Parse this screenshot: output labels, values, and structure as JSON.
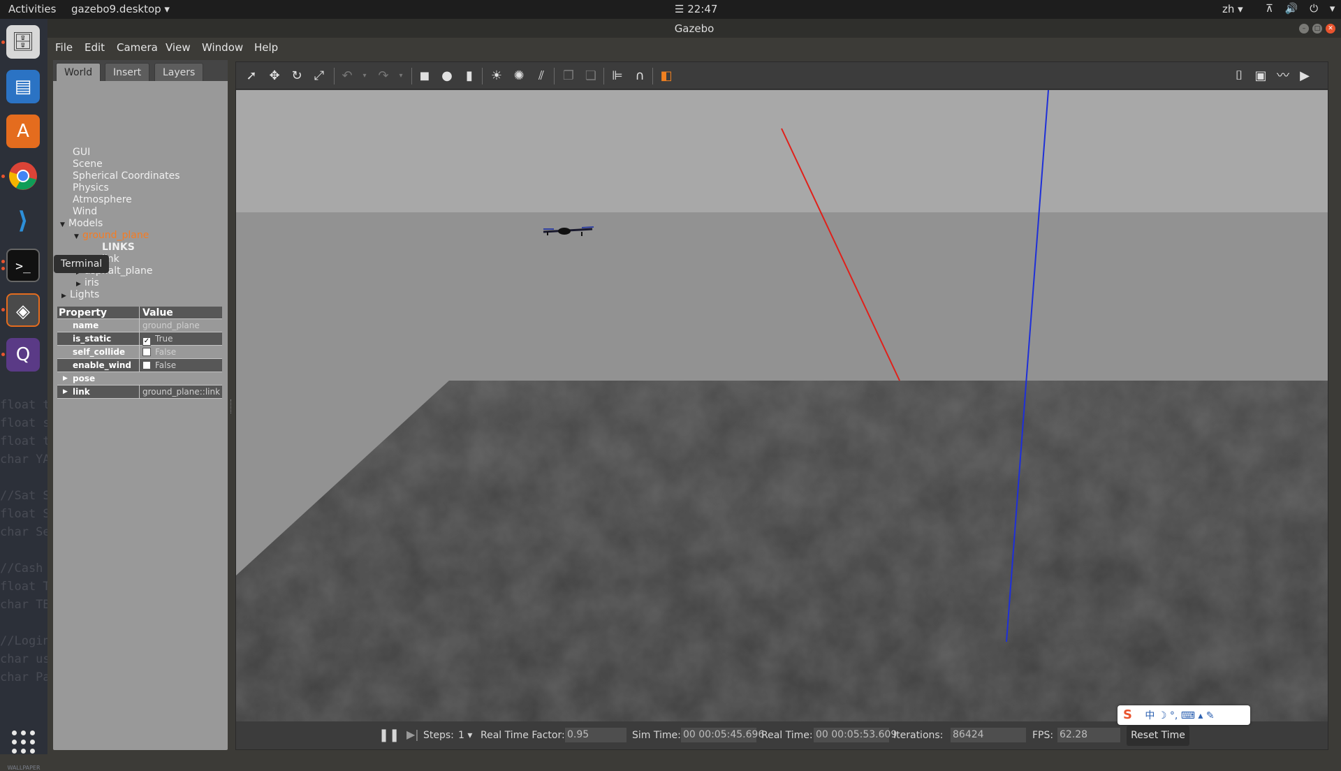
{
  "top_panel": {
    "activities": "Activities",
    "app_menu": "gazebo9.desktop ▾",
    "clock": "☰ 22:47",
    "language": "zh ▾",
    "tray": "⊼ 🔊 ⏻ ▾"
  },
  "window": {
    "title": "Gazebo",
    "minimize": "–",
    "maximize": "□",
    "close": "✕"
  },
  "menubar": {
    "file": "File",
    "edit": "Edit",
    "camera": "Camera",
    "view": "View",
    "window": "Window",
    "help": "Help"
  },
  "launcher": {
    "items": [
      "file-manager-icon",
      "writer-icon",
      "software-center-icon",
      "chrome-icon",
      "vscode-icon",
      "terminal-icon",
      "gazebo-icon",
      "qgroundcontrol-icon"
    ],
    "wallpaper_label": "WALLPAPER"
  },
  "side_panel": {
    "tabs": [
      "World",
      "Insert",
      "Layers"
    ],
    "active_tab": "World",
    "tree": {
      "gui": "GUI",
      "scene": "Scene",
      "spherical": "Spherical Coordinates",
      "physics": "Physics",
      "atmosphere": "Atmosphere",
      "wind": "Wind",
      "models": "Models",
      "ground_plane": "ground_plane",
      "links": "LINKS",
      "link": "link",
      "asphalt_plane": "asphalt_plane",
      "iris": "iris",
      "lights": "Lights"
    },
    "tooltip": "Terminal",
    "properties": {
      "header_property": "Property",
      "header_value": "Value",
      "name_key": "name",
      "name_val": "ground_plane",
      "is_static_key": "is_static",
      "is_static_val": "True",
      "self_collide_key": "self_collide",
      "self_collide_val": "False",
      "enable_wind_key": "enable_wind",
      "enable_wind_val": "False",
      "pose_key": "pose",
      "link_key": "link",
      "link_val": "ground_plane::link"
    }
  },
  "toolbar": {
    "icons": [
      "select-icon",
      "translate-icon",
      "rotate-icon",
      "scale-icon",
      "undo-icon",
      "redo-icon",
      "box-icon",
      "sphere-icon",
      "cylinder-icon",
      "point-light-icon",
      "spot-light-icon",
      "directional-light-icon",
      "copy-icon",
      "paste-icon",
      "align-icon",
      "snap-icon",
      "view-angle-icon",
      "screenshot-icon",
      "log-icon",
      "plot-icon",
      "record-icon"
    ]
  },
  "statusbar": {
    "steps_label": "Steps:",
    "steps_value": "1 ▾",
    "rtf_label": "Real Time Factor:",
    "rtf_value": "0.95",
    "sim_time_label": "Sim Time:",
    "sim_time_value": "00 00:05:45.696",
    "real_time_label": "Real Time:",
    "real_time_value": "00 00:05:53.609",
    "iterations_label": "Iterations:",
    "iterations_value": "86424",
    "fps_label": "FPS:",
    "fps_value": "62.28",
    "reset_time": "Reset Time"
  },
  "ime": {
    "logo": "S",
    "items": "中 ☽ °, ⌨ ▴ ✎"
  },
  "colors": {
    "accent_selected": "#f57c23",
    "x_axis": "#e0201a",
    "z_axis": "#1e2fd8",
    "sky": "#a6a6a6",
    "ground": "#454545"
  }
}
